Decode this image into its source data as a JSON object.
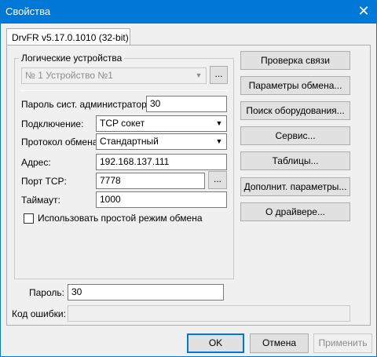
{
  "window": {
    "title": "Свойства",
    "close_icon": "✕"
  },
  "tab": {
    "label": "DrvFR v5.17.0.1010 (32-bit)"
  },
  "devices": {
    "group_label": "Логические устройства",
    "selected": "№ 1 Устройство №1",
    "browse_label": "..."
  },
  "form": {
    "admin_password_label": "Пароль сист. администратора:",
    "admin_password_value": "30",
    "connection_label": "Подключение:",
    "connection_value": "TCP сокет",
    "protocol_label": "Протокол обмена:",
    "protocol_value": "Стандартный",
    "address_label": "Адрес:",
    "address_value": "192.168.137.111",
    "tcp_port_label": "Порт TCP:",
    "tcp_port_value": "7778",
    "tcp_port_browse": "...",
    "timeout_label": "Таймаут:",
    "timeout_value": "1000",
    "simple_mode_label": "Использовать простой режим обмена",
    "simple_mode_checked": false
  },
  "side_buttons": [
    "Проверка связи",
    "Параметры обмена...",
    "Поиск оборудования...",
    "Сервис...",
    "Таблицы...",
    "Дополнит. параметры...",
    "О драйвере..."
  ],
  "bottom": {
    "password_label": "Пароль:",
    "password_value": "30",
    "error_code_label": "Код ошибки:",
    "error_code_value": ""
  },
  "footer": {
    "ok": "OK",
    "cancel": "Отмена",
    "apply": "Применить"
  },
  "colors": {
    "titlebar": "#0078d7",
    "accent_border": "#0078d7"
  }
}
